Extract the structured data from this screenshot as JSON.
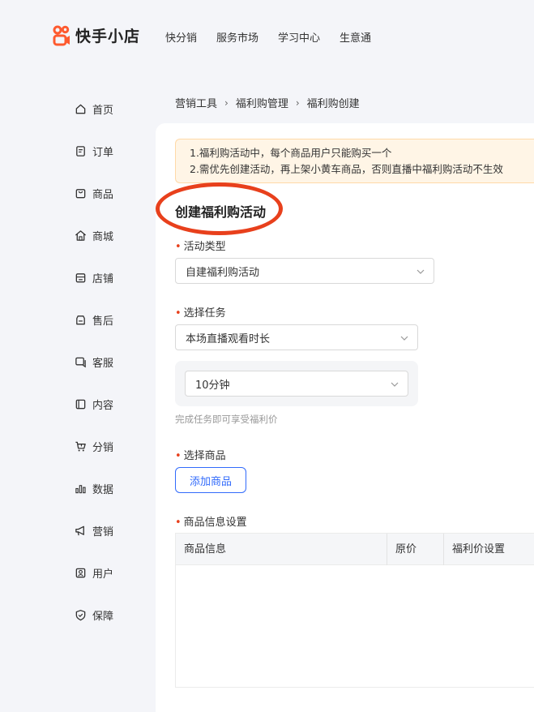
{
  "brand": {
    "name": "快手小店",
    "color": "#fe3666"
  },
  "topnav": [
    "快分销",
    "服务市场",
    "学习中心",
    "生意通"
  ],
  "sidebar": {
    "items": [
      {
        "label": "首页",
        "icon": "home-icon"
      },
      {
        "label": "订单",
        "icon": "order-icon"
      },
      {
        "label": "商品",
        "icon": "product-icon"
      },
      {
        "label": "商城",
        "icon": "mall-icon"
      },
      {
        "label": "店铺",
        "icon": "store-icon"
      },
      {
        "label": "售后",
        "icon": "aftersale-icon"
      },
      {
        "label": "客服",
        "icon": "customer-service-icon"
      },
      {
        "label": "内容",
        "icon": "content-icon"
      },
      {
        "label": "分销",
        "icon": "distribution-icon"
      },
      {
        "label": "数据",
        "icon": "data-icon"
      },
      {
        "label": "营销",
        "icon": "marketing-icon"
      },
      {
        "label": "用户",
        "icon": "user-icon"
      },
      {
        "label": "保障",
        "icon": "shield-icon"
      }
    ]
  },
  "breadcrumb": [
    "营销工具",
    "福利购管理",
    "福利购创建"
  ],
  "breadcrumb_separator": "›",
  "notice": {
    "lines": [
      "1.福利购活动中，每个商品用户只能购买一个",
      "2.需优先创建活动，再上架小黄车商品，否则直播中福利购活动不生效"
    ]
  },
  "form": {
    "title": "创建福利购活动",
    "activity_type": {
      "label": "活动类型",
      "value": "自建福利购活动"
    },
    "task": {
      "label": "选择任务",
      "value": "本场直播观看时长",
      "sub_value": "10分钟",
      "hint": "完成任务即可享受福利价"
    },
    "product": {
      "label": "选择商品",
      "add_button": "添加商品"
    },
    "product_info": {
      "label": "商品信息设置",
      "columns": [
        "商品信息",
        "原价",
        "福利价设置"
      ]
    }
  },
  "colors": {
    "accent": "#326bfb",
    "required": "#e8401c",
    "annotation": "#e8401c",
    "notice_bg": "#fff5e6"
  }
}
